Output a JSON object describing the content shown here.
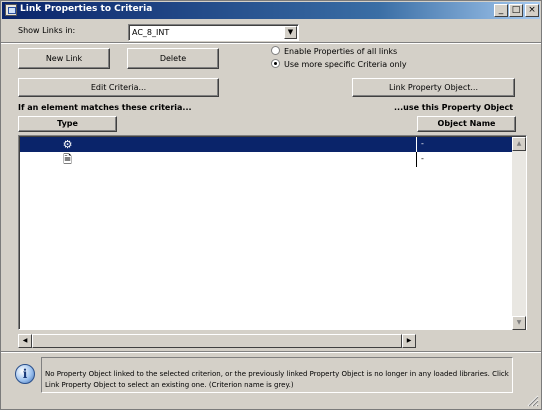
{
  "window": {
    "title": "Link Properties to Criteria",
    "controls": {
      "minimize": "_",
      "maximize": "□",
      "close": "×"
    }
  },
  "show_links": {
    "label": "Show Links in:",
    "selected": "AC_8_INT"
  },
  "buttons": {
    "new_link": "New Link",
    "delete": "Delete",
    "edit_criteria": "Edit Criteria...",
    "link_property_object": "Link Property Object..."
  },
  "options": {
    "enable_all": "Enable Properties of all links",
    "more_specific": "Use more specific Criteria only",
    "selected": "more_specific"
  },
  "list": {
    "left_header": "If an element matches these criteria...",
    "right_header": "...use this Property Object",
    "columns": {
      "type": "Type",
      "object_name": "Object Name"
    },
    "rows": [
      {
        "icon": "criteria-icon",
        "object": "-",
        "selected": true
      },
      {
        "icon": "document-icon",
        "object": "-",
        "selected": false
      }
    ]
  },
  "info": {
    "icon": "info-icon",
    "text": "No Property Object linked to the selected criterion, or the previously linked Property Object is no longer in any loaded libraries. Click Link Property Object to select an existing one. (Criterion name is grey.)"
  }
}
